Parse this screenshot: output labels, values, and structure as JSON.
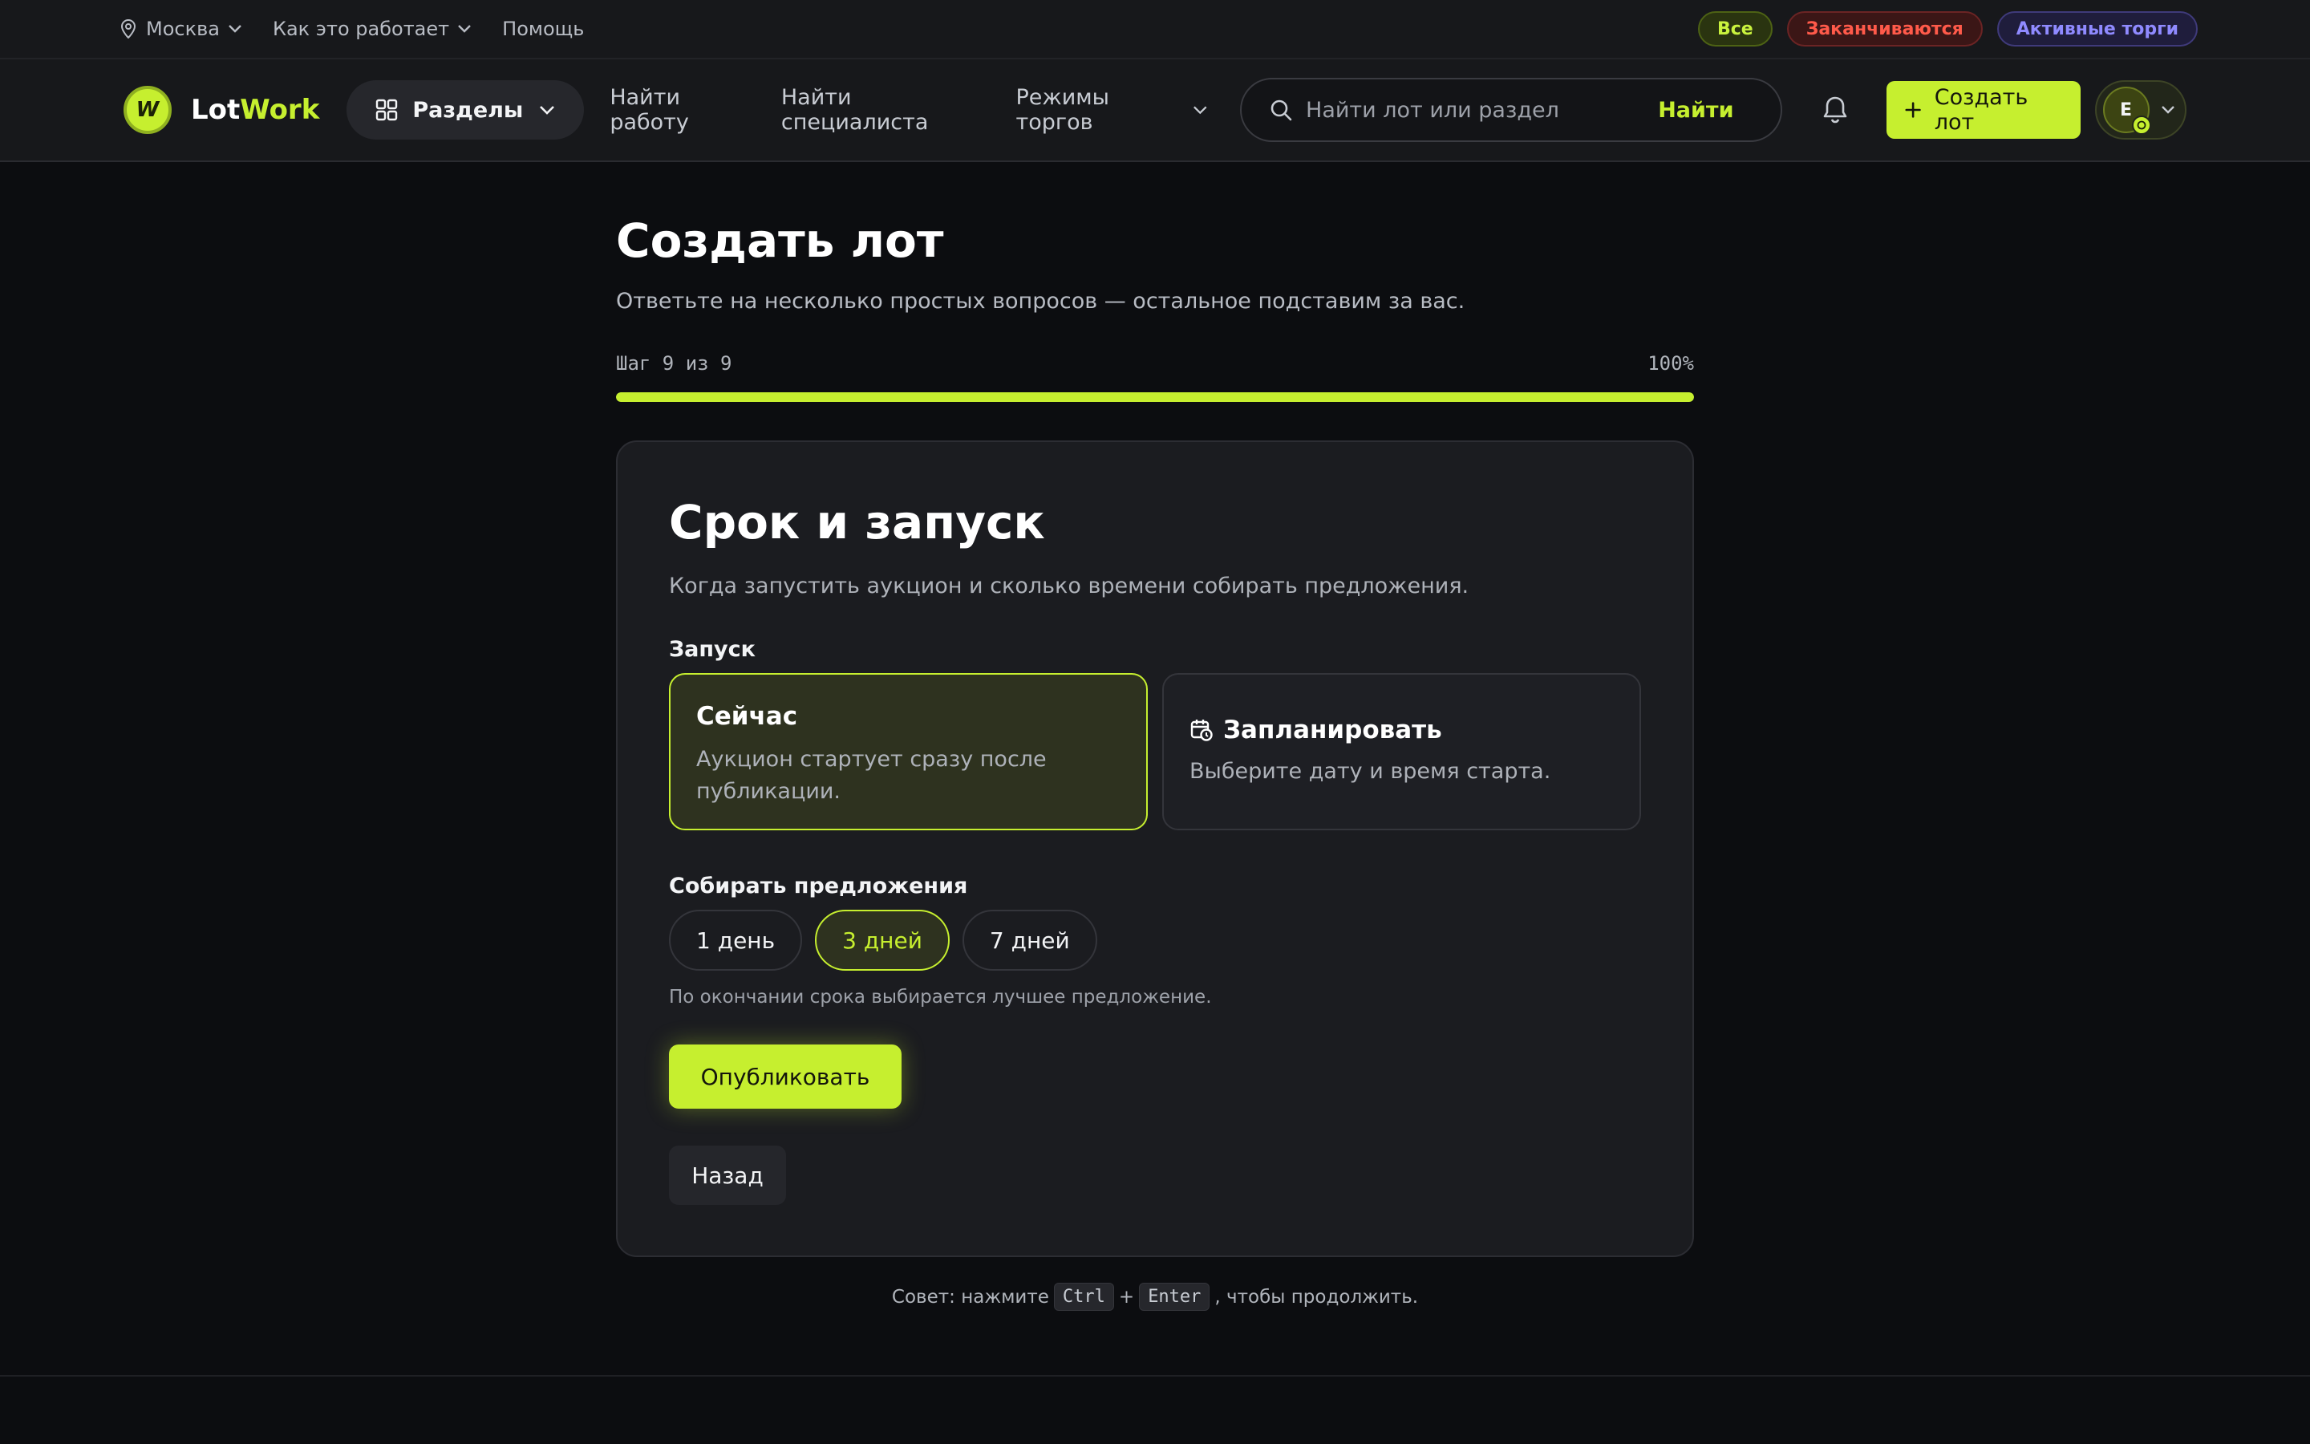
{
  "topbar": {
    "city": "Москва",
    "how_it_works": "Как это работает",
    "help": "Помощь",
    "filters": {
      "all": "Все",
      "ending": "Заканчиваются",
      "active": "Активные торги"
    }
  },
  "header": {
    "logo_part1": "Lot",
    "logo_part2": "Work",
    "logo_mark": "W",
    "sections": "Разделы",
    "nav": {
      "find_work": "Найти работу",
      "find_specialist": "Найти специалиста",
      "trade_modes": "Режимы торгов"
    },
    "search": {
      "placeholder": "Найти лот или раздел",
      "button": "Найти"
    },
    "create_lot": "Создать лот",
    "user_initial": "E"
  },
  "page": {
    "title": "Создать лот",
    "subtitle": "Ответьте на несколько простых вопросов — остальное подставим за вас.",
    "step_label": "Шаг 9 из 9",
    "progress_label": "100%",
    "progress_value": 1.0
  },
  "card": {
    "title": "Срок и запуск",
    "subtitle": "Когда запустить аукцион и сколько времени собирать предложения.",
    "launch_label": "Запуск",
    "launch_options": [
      {
        "title": "Сейчас",
        "desc": "Аукцион стартует сразу после публикации.",
        "selected": true
      },
      {
        "title": "Запланировать",
        "desc": "Выберите дату и время старта.",
        "selected": false
      }
    ],
    "collect_label": "Собирать предложения",
    "durations": [
      {
        "label": "1 день",
        "selected": false
      },
      {
        "label": "3 дней",
        "selected": true
      },
      {
        "label": "7 дней",
        "selected": false
      }
    ],
    "hint": "По окончании срока выбирается лучшее предложение.",
    "publish": "Опубликовать",
    "back": "Назад"
  },
  "tip": {
    "prefix": "Совет: нажмите",
    "key1": "Ctrl",
    "plus": "+",
    "key2": "Enter",
    "suffix": ", чтобы продолжить."
  },
  "colors": {
    "accent": "#c6ef2f",
    "background": "#0c0d10",
    "danger": "#ff5a4a",
    "violet": "#8f8aff"
  },
  "icons": [
    "location-pin-icon",
    "chevron-down-icon",
    "grid-icon",
    "search-icon",
    "bell-icon",
    "plus-icon",
    "calendar-clock-icon"
  ]
}
